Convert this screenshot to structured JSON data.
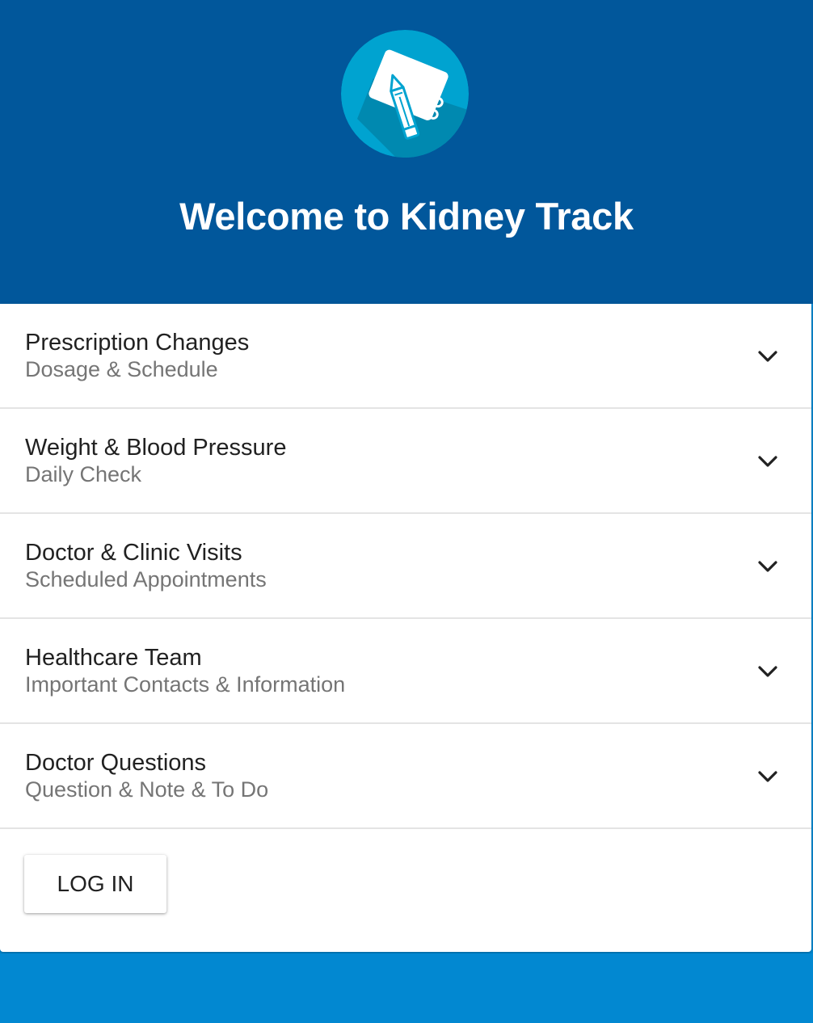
{
  "header": {
    "title": "Welcome to Kidney Track",
    "logo_icon": "notepad-pencil-icon"
  },
  "menu": [
    {
      "title": "Prescription Changes",
      "subtitle": "Dosage & Schedule",
      "icon": "chevron-down-icon"
    },
    {
      "title": "Weight & Blood Pressure",
      "subtitle": "Daily Check",
      "icon": "chevron-down-icon"
    },
    {
      "title": "Doctor & Clinic Visits",
      "subtitle": "Scheduled Appointments",
      "icon": "chevron-down-icon"
    },
    {
      "title": "Healthcare Team",
      "subtitle": "Important Contacts & Information",
      "icon": "chevron-down-icon"
    },
    {
      "title": "Doctor Questions",
      "subtitle": "Question & Note & To Do",
      "icon": "chevron-down-icon"
    }
  ],
  "login": {
    "label": "LOG IN"
  },
  "colors": {
    "header_bg": "#01579b",
    "footer_bg": "#0288d1",
    "logo_circle": "#00a3d0",
    "logo_shadow": "#0089b0",
    "title_text": "#ffffff",
    "item_title": "#212121",
    "item_subtitle": "#757575"
  }
}
